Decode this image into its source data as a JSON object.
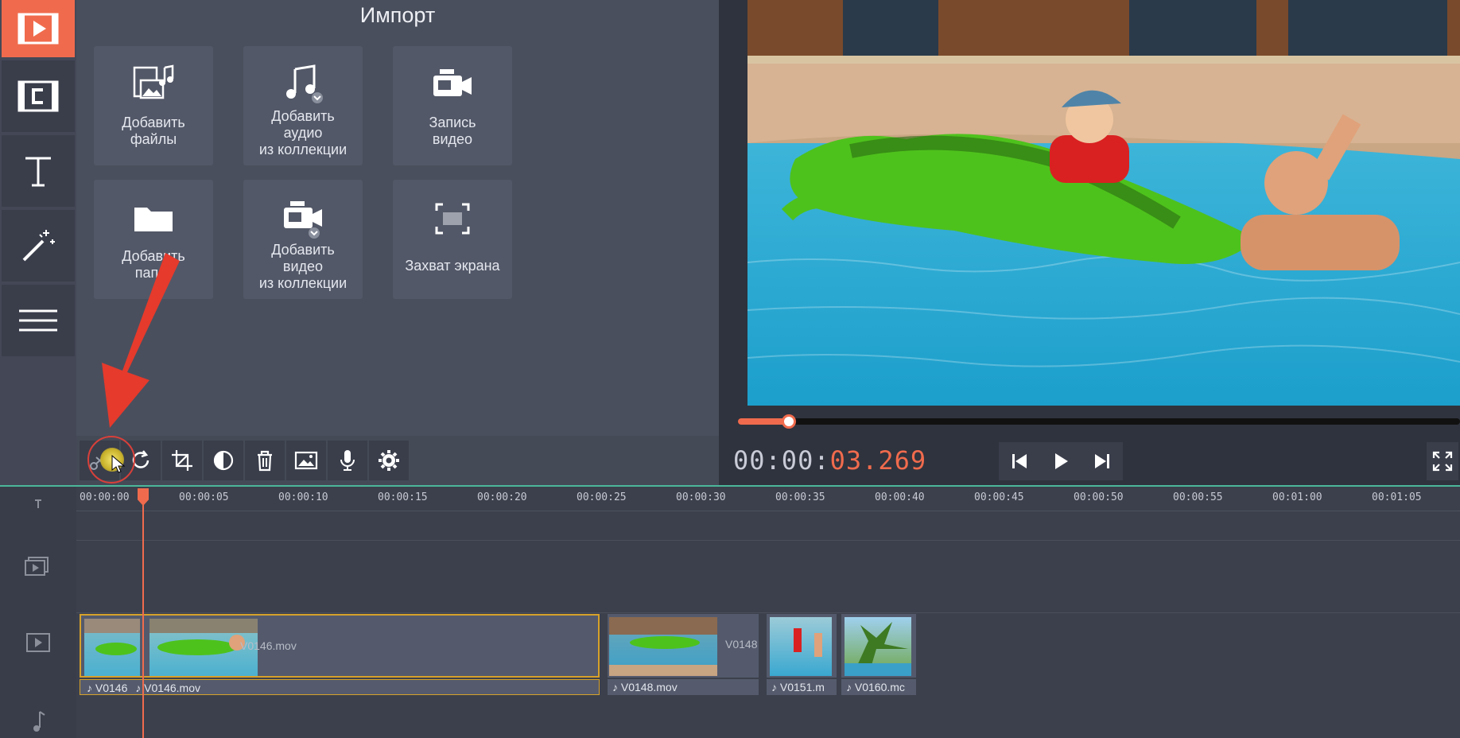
{
  "import_panel": {
    "title": "Импорт",
    "tiles": [
      {
        "label": "Добавить\nфайлы",
        "icon": "add-files-icon"
      },
      {
        "label": "Добавить\nаудио\nиз коллекции",
        "icon": "add-audio-collection-icon"
      },
      {
        "label": "Запись\nвидео",
        "icon": "record-video-icon"
      },
      {
        "label": "Добавить\nпапку",
        "icon": "add-folder-icon"
      },
      {
        "label": "Добавить\nвидео\nиз коллекции",
        "icon": "add-video-collection-icon"
      },
      {
        "label": "Захват экрана",
        "icon": "screen-capture-icon"
      }
    ]
  },
  "left_nav": [
    {
      "name": "import",
      "icon": "film-import-icon",
      "active": true
    },
    {
      "name": "transitions",
      "icon": "transition-icon",
      "active": false
    },
    {
      "name": "titles",
      "icon": "text-icon",
      "active": false
    },
    {
      "name": "effects",
      "icon": "magic-wand-icon",
      "active": false
    },
    {
      "name": "menu",
      "icon": "hamburger-icon",
      "active": false
    }
  ],
  "toolbar": [
    "cut-icon",
    "rotate-icon",
    "crop-icon",
    "color-adjust-icon",
    "delete-icon",
    "image-icon",
    "microphone-icon",
    "settings-icon"
  ],
  "player": {
    "timecode_main": "00:00:",
    "timecode_ms": "03.269",
    "progress": 0.07
  },
  "timeline": {
    "ticks": [
      "00:00:00",
      "00:00:05",
      "00:00:10",
      "00:00:15",
      "00:00:20",
      "00:00:25",
      "00:00:30",
      "00:00:35",
      "00:00:40",
      "00:00:45",
      "00:00:50",
      "00:00:55",
      "00:01:00",
      "00:01:05"
    ],
    "video_clips": [
      "V0146.mov",
      "V0148",
      "",
      ""
    ],
    "audio_clips": [
      "V0146",
      "V0146.mov",
      "V0148.mov",
      "V0151.m",
      "V0160.mc"
    ]
  },
  "colors": {
    "accent": "#f06b4d",
    "timeline_line": "#4bb79a",
    "selection": "#d6a12a"
  }
}
